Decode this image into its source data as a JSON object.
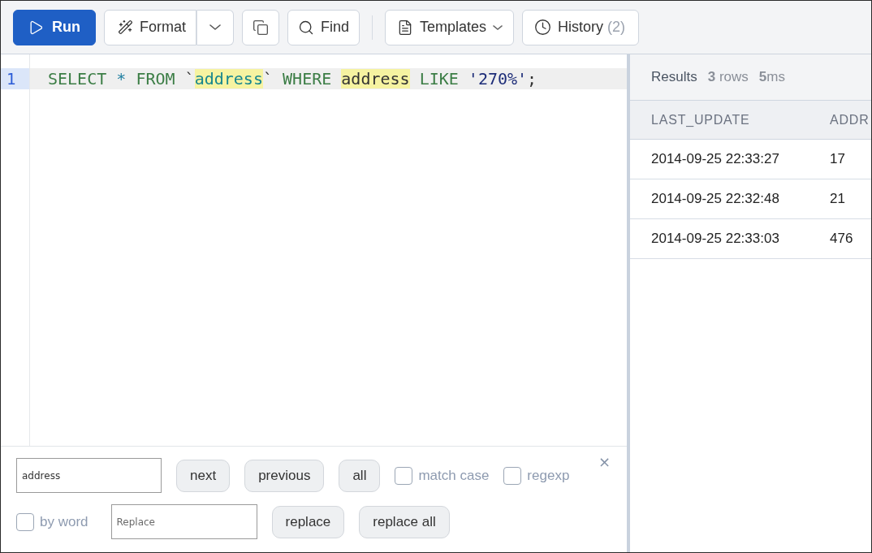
{
  "toolbar": {
    "run_button": {
      "label": "Run"
    },
    "format_button": {
      "label": "Format"
    },
    "find_button": {
      "label": "Find"
    },
    "templates_button": {
      "label": "Templates"
    },
    "history_button": {
      "label": "History",
      "count": "(2)"
    }
  },
  "editor": {
    "lines": [
      {
        "number": "1",
        "active": true,
        "tokens": [
          {
            "text": "SELECT ",
            "kind": "keyword",
            "match": false
          },
          {
            "text": "* ",
            "kind": "operator",
            "match": false
          },
          {
            "text": "FROM ",
            "kind": "keyword",
            "match": false
          },
          {
            "text": "`",
            "kind": "plain",
            "match": false
          },
          {
            "text": "address",
            "kind": "identifier",
            "match": true
          },
          {
            "text": "` ",
            "kind": "plain",
            "match": false
          },
          {
            "text": "WHERE ",
            "kind": "keyword",
            "match": false
          },
          {
            "text": "address",
            "kind": "plain",
            "match": true
          },
          {
            "text": " LIKE ",
            "kind": "keyword",
            "match": false
          },
          {
            "text": "'270%'",
            "kind": "string",
            "match": false
          },
          {
            "text": ";",
            "kind": "plain",
            "match": false
          }
        ]
      }
    ]
  },
  "search_panel": {
    "find_row": {
      "field": {
        "value": "address"
      },
      "buttons": [
        "next",
        "previous",
        "all"
      ],
      "options": [
        {
          "label": "match case",
          "checked": false
        },
        {
          "label": "regexp",
          "checked": false
        }
      ],
      "close_label": "×"
    },
    "replace_row": {
      "options": [
        {
          "label": "by word",
          "checked": false
        }
      ],
      "field": {
        "placeholder": "Replace"
      },
      "buttons": [
        "replace",
        "replace all"
      ]
    }
  },
  "results": {
    "title": "Results",
    "row_count": "**3** rows",
    "duration": "**5**ms",
    "table": {
      "columns": [
        "LAST_UPDATE",
        "ADDR"
      ],
      "rows": [
        [
          "2014-09-25 22:33:27",
          "17"
        ],
        [
          "2014-09-25 22:32:48",
          "21"
        ],
        [
          "2014-09-25 22:33:03",
          "476"
        ]
      ]
    }
  }
}
